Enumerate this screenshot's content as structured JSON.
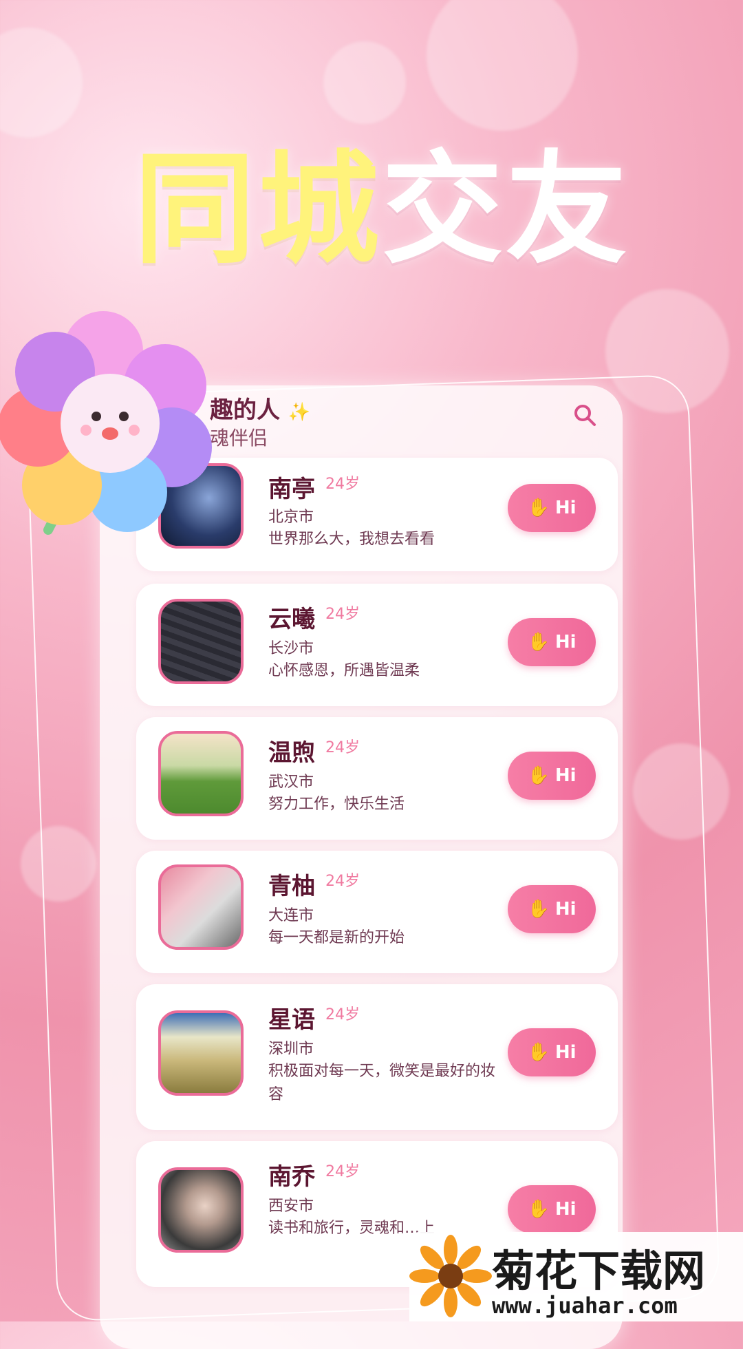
{
  "banner": {
    "title_part1": "同城",
    "title_part2": "交友"
  },
  "card_header": {
    "title": "趣的人",
    "sparkle": "✨",
    "subtitle": "魂伴侣"
  },
  "users": [
    {
      "name": "南亭",
      "age": "24岁",
      "city": "北京市",
      "bio": "世界那么大，我想去看看",
      "hi_label": "Hi"
    },
    {
      "name": "云曦",
      "age": "24岁",
      "city": "长沙市",
      "bio": "心怀感恩，所遇皆温柔",
      "hi_label": "Hi"
    },
    {
      "name": "温煦",
      "age": "24岁",
      "city": "武汉市",
      "bio": "努力工作，快乐生活",
      "hi_label": "Hi"
    },
    {
      "name": "青柚",
      "age": "24岁",
      "city": "大连市",
      "bio": "每一天都是新的开始",
      "hi_label": "Hi"
    },
    {
      "name": "星语",
      "age": "24岁",
      "city": "深圳市",
      "bio": "积极面对每一天，微笑是最好的妆容",
      "hi_label": "Hi"
    },
    {
      "name": "南乔",
      "age": "24岁",
      "city": "西安市",
      "bio": "读书和旅行，灵魂和…上",
      "hi_label": "Hi"
    }
  ],
  "watermark": {
    "title": "菊花下载网",
    "url": "www.juahar.com"
  },
  "colors": {
    "accent": "#f0699a",
    "title_yellow": "#fff37b",
    "text_dark": "#5c1631"
  }
}
